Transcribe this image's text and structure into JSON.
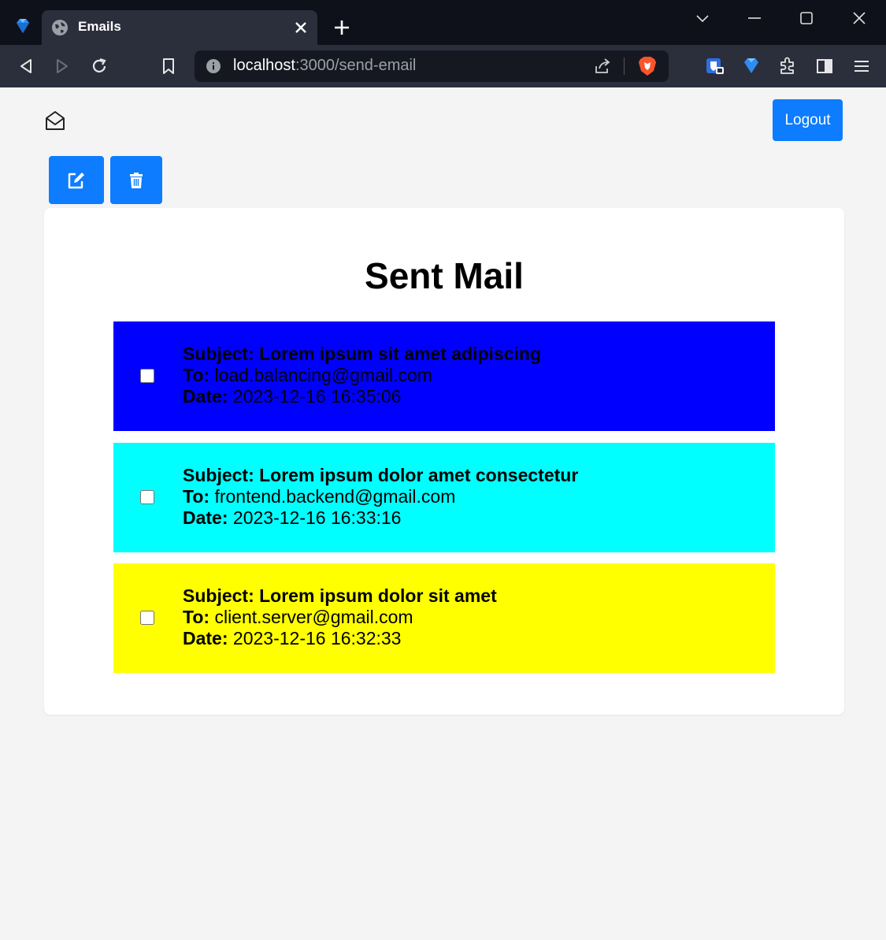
{
  "browser": {
    "tab_title": "Emails",
    "url_host": "localhost",
    "url_path": ":3000/send-email"
  },
  "header": {
    "logout_label": "Logout"
  },
  "main": {
    "title": "Sent Mail",
    "labels": {
      "subject": "Subject:",
      "to": "To:",
      "date": "Date:"
    },
    "emails": [
      {
        "subject": "Lorem ipsum sit amet adipiscing",
        "to": "load.balancing@gmail.com",
        "date": "2023-12-16 16:35:06",
        "color": "#0000ff",
        "checked": false
      },
      {
        "subject": "Lorem ipsum dolor amet consectetur",
        "to": "frontend.backend@gmail.com",
        "date": "2023-12-16 16:33:16",
        "color": "#00ffff",
        "checked": false
      },
      {
        "subject": "Lorem ipsum dolor sit amet",
        "to": "client.server@gmail.com",
        "date": "2023-12-16 16:32:33",
        "color": "#ffff00",
        "checked": false
      }
    ]
  },
  "colors": {
    "accent": "#0d7cff"
  },
  "icons": [
    "gem-icon",
    "globe-icon",
    "close-icon",
    "plus-icon",
    "back-icon",
    "forward-icon",
    "reload-icon",
    "bookmark-icon",
    "info-icon",
    "share-icon",
    "brave-lion-icon",
    "shield-icon",
    "extensions-icon",
    "sidebar-icon",
    "menu-icon",
    "envelope-open-icon",
    "edit-icon",
    "trash-icon"
  ]
}
